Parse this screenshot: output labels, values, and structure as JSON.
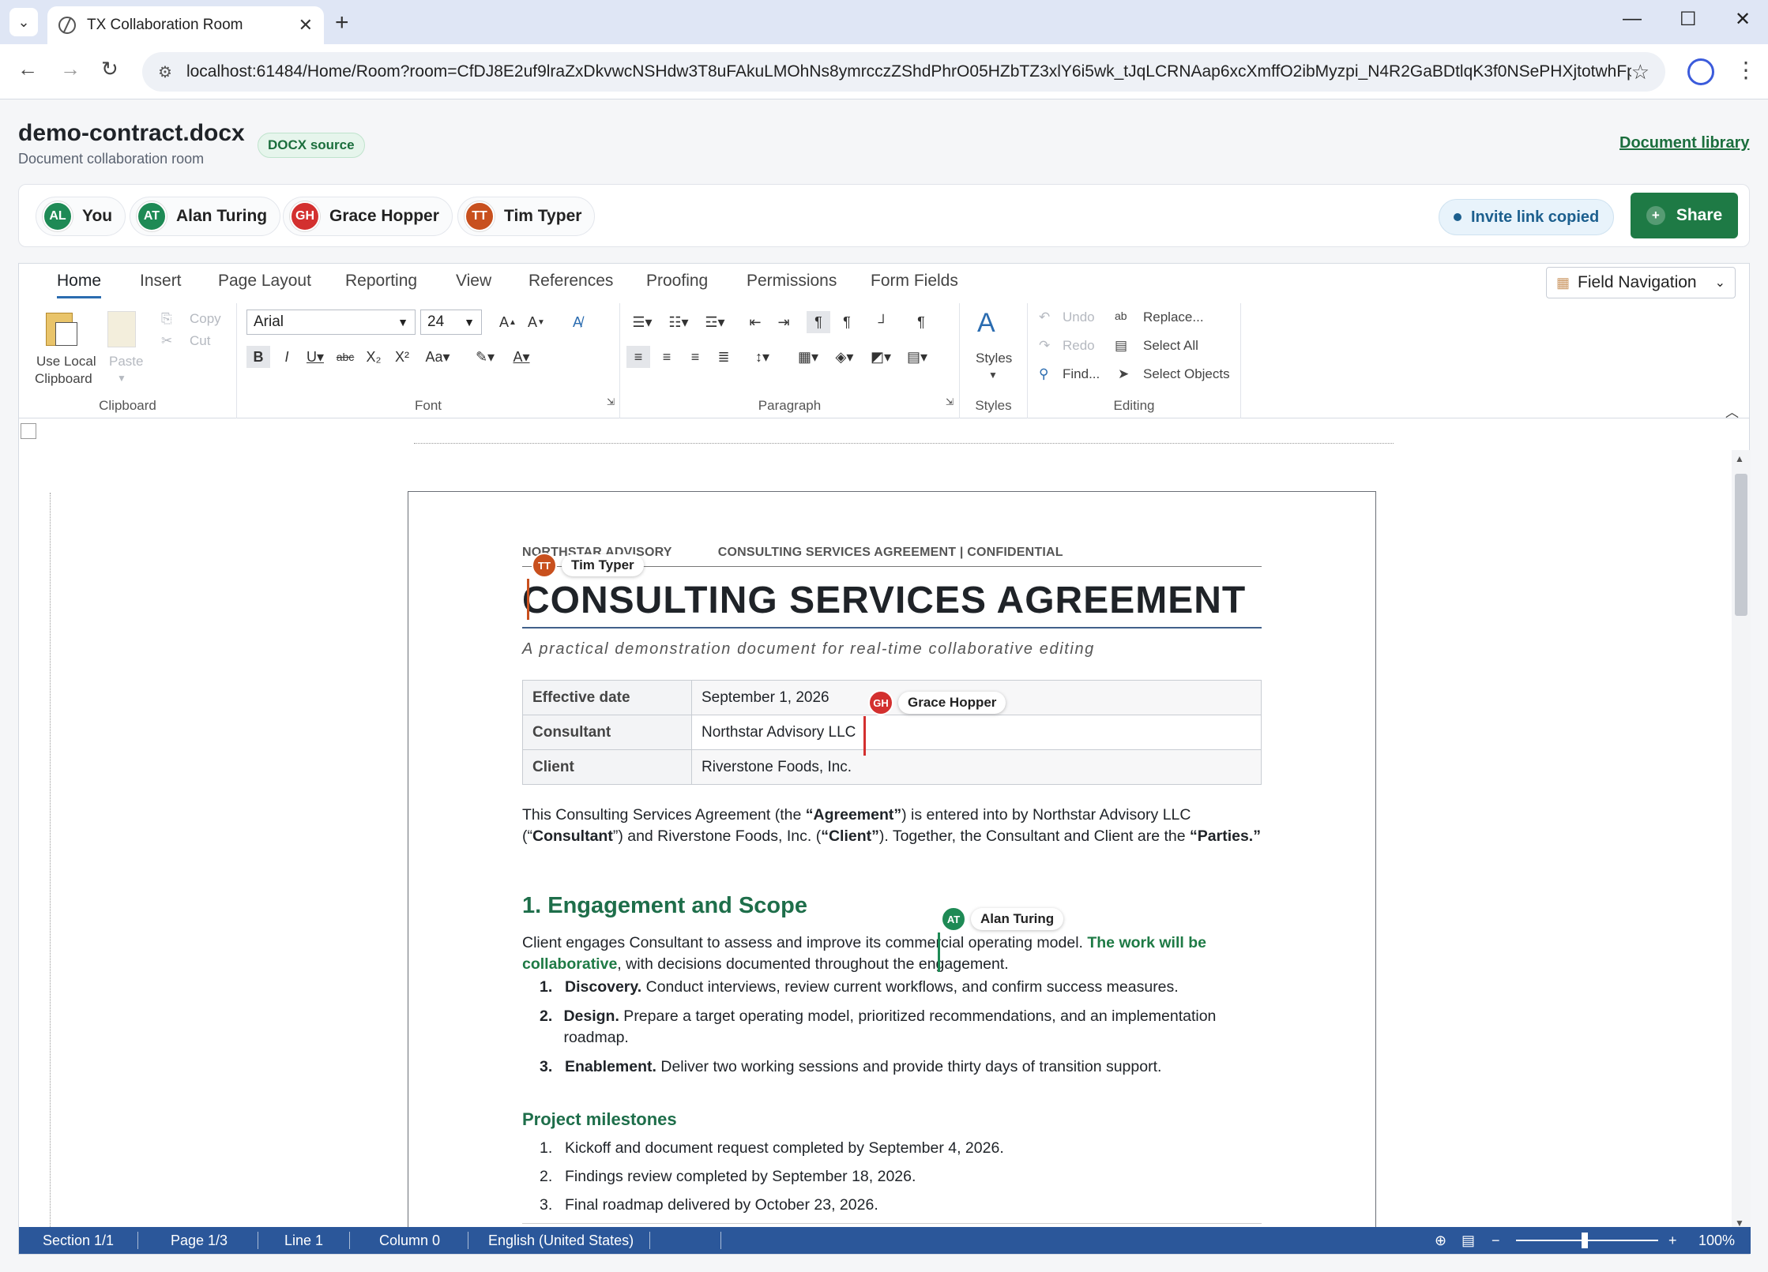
{
  "browser": {
    "tab_title": "TX Collaboration Room",
    "url": "localhost:61484/Home/Room?room=CfDJ8E2uf9lraZxDkvwcNSHdw3T8uFAkuLMOhNs8ymrcczZShdPhrO05HZbTZ3xlY6i5wk_tJqLCRNAap6xcXmffO2ibMyzpi_N4R2GaBDtlqK3f0NSePHXjtotwhFp8..."
  },
  "header": {
    "title": "demo-contract.docx",
    "badge": "DOCX source",
    "subtitle": "Document collaboration room",
    "library_link": "Document library"
  },
  "presence": {
    "users": [
      {
        "initials": "AL",
        "name": "You",
        "color": "#1e8a55"
      },
      {
        "initials": "AT",
        "name": "Alan Turing",
        "color": "#1e8a55"
      },
      {
        "initials": "GH",
        "name": "Grace Hopper",
        "color": "#d3302f"
      },
      {
        "initials": "TT",
        "name": "Tim Typer",
        "color": "#c8501e"
      }
    ],
    "invite_status": "Invite link copied",
    "share_label": "Share"
  },
  "ribbon": {
    "tabs": [
      "Home",
      "Insert",
      "Page Layout",
      "Reporting",
      "View",
      "References",
      "Proofing",
      "Permissions",
      "Form Fields"
    ],
    "field_navigation": "Field Navigation",
    "clipboard": {
      "use_local": "Use Local",
      "clipboard": "Clipboard",
      "paste": "Paste",
      "copy": "Copy",
      "cut": "Cut",
      "label": "Clipboard"
    },
    "font": {
      "family": "Arial",
      "size": "24",
      "label": "Font"
    },
    "paragraph": {
      "label": "Paragraph"
    },
    "styles": {
      "button": "Styles",
      "label": "Styles"
    },
    "editing": {
      "undo": "Undo",
      "redo": "Redo",
      "find": "Find...",
      "replace": "Replace...",
      "select_all": "Select All",
      "select_objects": "Select Objects",
      "label": "Editing"
    }
  },
  "document": {
    "header_left": "NORTHSTAR ADVISORY",
    "header_right": "CONSULTING SERVICES AGREEMENT |  CONFIDENTIAL",
    "title": "CONSULTING SERVICES AGREEMENT",
    "subtitle": "A practical demonstration document for real-time collaborative editing",
    "table": [
      {
        "key": "Effective date",
        "value": "September 1, 2026"
      },
      {
        "key": "Consultant",
        "value": "Northstar Advisory LLC"
      },
      {
        "key": "Client",
        "value": "Riverstone Foods, Inc."
      }
    ],
    "intro": {
      "p1": "This Consulting Services Agreement (the ",
      "b1": "“Agreement”",
      "p2": ") is entered into by Northstar Advisory LLC (“",
      "b2": "Consultant",
      "p3": "”) and Riverstone Foods, Inc. (",
      "b3": "“Client”",
      "p4": "). Together, the Consultant and Client are the ",
      "b4": "“Parties.”"
    },
    "section1": {
      "heading": "1. Engagement and Scope",
      "p1": "Client engages Consultant to assess and improve its commercial operating model. ",
      "g1": "The work will be collaborative",
      "p2": ", with decisions documented throughout the engagement.",
      "items": [
        {
          "n": "1.",
          "term": "Discovery.",
          "text": " Conduct interviews, review current workflows, and confirm success measures."
        },
        {
          "n": "2.",
          "term": "Design.",
          "text": " Prepare a target operating model, prioritized recommendations, and an implementation roadmap."
        },
        {
          "n": "3.",
          "term": "Enablement.",
          "text": " Deliver two working sessions and provide thirty days of transition support."
        }
      ]
    },
    "milestones": {
      "heading": "Project milestones",
      "items": [
        {
          "n": "1.",
          "text": "Kickoff and document request completed by September 4, 2026."
        },
        {
          "n": "2.",
          "text": "Findings review completed by September 18, 2026."
        },
        {
          "n": "3.",
          "text": "Final roadmap delivered by October 23, 2026."
        }
      ]
    }
  },
  "cursors": [
    {
      "initials": "TT",
      "name": "Tim Typer",
      "color": "#c8501e"
    },
    {
      "initials": "GH",
      "name": "Grace Hopper",
      "color": "#d3302f"
    },
    {
      "initials": "AT",
      "name": "Alan Turing",
      "color": "#1e8a55"
    }
  ],
  "status": {
    "section": "Section 1/1",
    "page": "Page 1/3",
    "line": "Line 1",
    "column": "Column 0",
    "language": "English (United States)",
    "zoom": "100%"
  }
}
